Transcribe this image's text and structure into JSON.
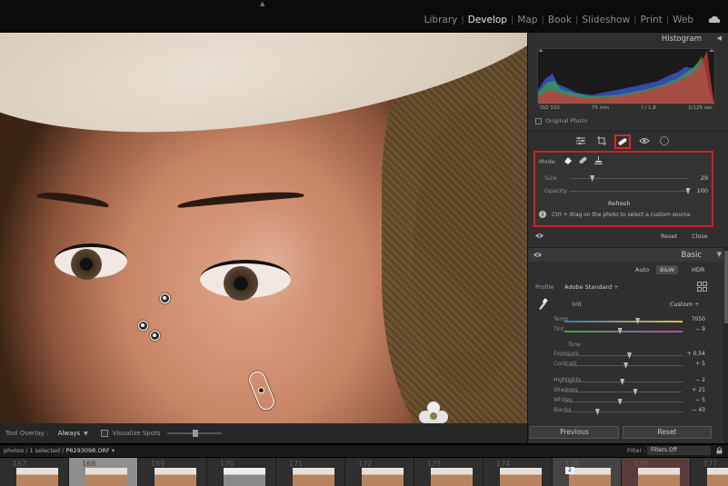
{
  "modules": {
    "items": [
      "Library",
      "Develop",
      "Map",
      "Book",
      "Slideshow",
      "Print",
      "Web"
    ],
    "active": "Develop"
  },
  "histogram": {
    "title": "Histogram",
    "iso": "ISO 320",
    "focal": "75 mm",
    "aperture": "f / 1.8",
    "shutter": "1/125 sec",
    "original_photo": "Original Photo"
  },
  "heal": {
    "mode_label": "Mode",
    "size_label": "Size",
    "size_value": "29",
    "size_fraction": 0.19,
    "opacity_label": "Opacity",
    "opacity_value": "100",
    "opacity_fraction": 1.0,
    "refresh": "Refresh",
    "hint": "Ctrl + drag on the photo to select a custom source",
    "reset": "Reset",
    "close": "Close"
  },
  "basic": {
    "title": "Basic",
    "treatments": [
      "Auto",
      "B&W",
      "HDR"
    ],
    "profile_label": "Profile",
    "profile_value": "Adobe Standard ÷",
    "wb_label": "WB",
    "wb_value": "Custom ÷",
    "tone_label": "Tone",
    "sliders": [
      {
        "label": "Temp",
        "value": "7050",
        "fraction": 0.62
      },
      {
        "label": "Tint",
        "value": "− 9",
        "fraction": 0.47
      },
      {
        "label": "Exposure",
        "value": "+ 0,54",
        "fraction": 0.55
      },
      {
        "label": "Contrast",
        "value": "+ 5",
        "fraction": 0.52
      },
      {
        "label": "Highlights",
        "value": "− 2",
        "fraction": 0.49
      },
      {
        "label": "Shadows",
        "value": "+ 21",
        "fraction": 0.6
      },
      {
        "label": "Whites",
        "value": "− 5",
        "fraction": 0.47
      },
      {
        "label": "Blacks",
        "value": "− 43",
        "fraction": 0.28
      }
    ]
  },
  "buttons": {
    "previous": "Previous",
    "reset": "Reset"
  },
  "tool_overlay": {
    "label": "Tool Overlay :",
    "value": "Always",
    "visualize": "Visualize Spots"
  },
  "filmstrip_header": {
    "prefix": "photos / 1 selected /",
    "filename": "P6293098.ORF",
    "filter_label": "Filter :",
    "filter_value": "Filters Off"
  },
  "filmstrip": [
    {
      "num": "167"
    },
    {
      "num": "168"
    },
    {
      "num": "169"
    },
    {
      "num": "170"
    },
    {
      "num": "171"
    },
    {
      "num": "172"
    },
    {
      "num": "173"
    },
    {
      "num": "174"
    },
    {
      "num": "175"
    },
    {
      "num": "176"
    },
    {
      "num": "177"
    }
  ],
  "colors": {
    "highlight_red": "#d41f1f"
  }
}
